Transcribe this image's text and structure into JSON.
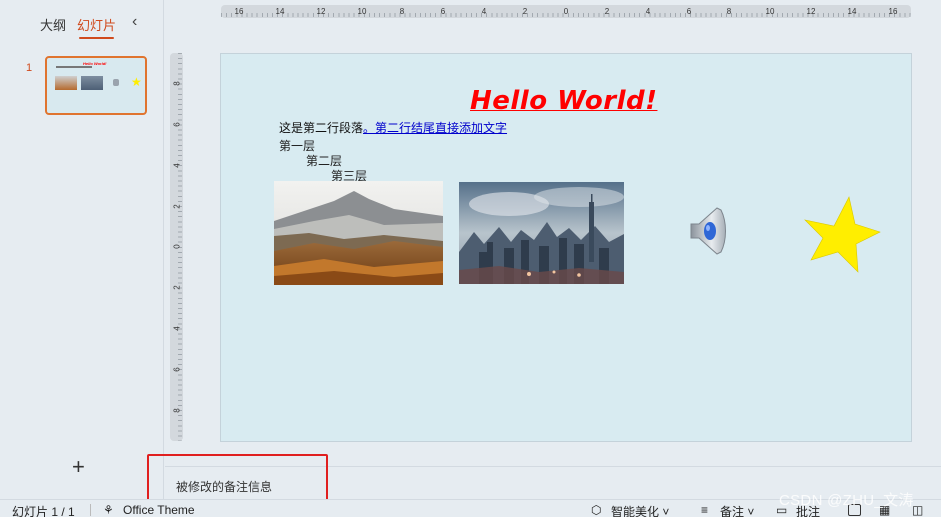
{
  "left_panel": {
    "tab_outline": "大纲",
    "tab_slides": "幻灯片",
    "collapse_glyph": "‹",
    "slide_number": "1",
    "add_glyph": "+"
  },
  "ruler": {
    "horizontal_labels": [
      "16",
      "14",
      "12",
      "10",
      "8",
      "6",
      "4",
      "2",
      "0",
      "2",
      "4",
      "6",
      "8",
      "10",
      "12",
      "14",
      "16"
    ],
    "vertical_labels": [
      "8",
      "6",
      "4",
      "2",
      "0",
      "2",
      "4",
      "6",
      "8"
    ]
  },
  "slide": {
    "title": "Hello World!",
    "paragraph_text": "这是第二行段落",
    "paragraph_link": "。第二行结尾直接添加文字",
    "level1": "第一层",
    "level2": "第二层",
    "level3": "第三层",
    "image1_icon": "mountain-photo",
    "image2_icon": "city-photo",
    "audio_icon": "speaker-icon",
    "shape_icon": "star-shape",
    "star_color": "#ffee00",
    "title_color": "#ff0000"
  },
  "notes": {
    "text": "被修改的备注信息"
  },
  "statusbar": {
    "slide_counter": "幻灯片 1 / 1",
    "theme": "Office Theme",
    "beautify": "智能美化",
    "notes": "备注",
    "comment": "批注"
  },
  "watermark": "CSDN @ZHU_文涛"
}
